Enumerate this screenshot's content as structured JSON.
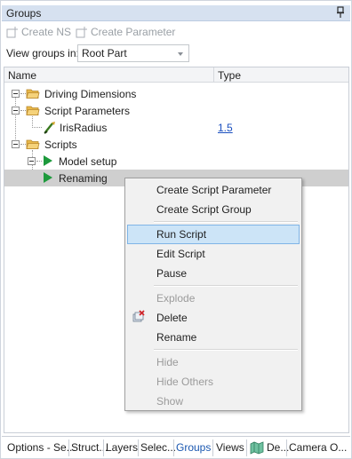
{
  "panel": {
    "title": "Groups"
  },
  "toolbar": {
    "create_ns": "Create NS",
    "create_parameter": "Create Parameter"
  },
  "view_groups": {
    "label": "View groups in:",
    "selected": "Root Part"
  },
  "grid": {
    "columns": [
      "Name",
      "Type"
    ],
    "rows": [
      {
        "label": "Driving Dimensions",
        "type": ""
      },
      {
        "label": "Script Parameters",
        "type": ""
      },
      {
        "label": "IrisRadius",
        "type": "1.5"
      },
      {
        "label": "Scripts",
        "type": ""
      },
      {
        "label": "Model setup",
        "type": ""
      },
      {
        "label": "Renaming",
        "type": ""
      }
    ]
  },
  "context_menu": {
    "items": [
      {
        "label": "Create Script Parameter",
        "enabled": true
      },
      {
        "label": "Create Script Group",
        "enabled": true
      },
      {
        "label": "Run Script",
        "enabled": true,
        "highlighted": true
      },
      {
        "label": "Edit Script",
        "enabled": true
      },
      {
        "label": "Pause",
        "enabled": true
      },
      {
        "label": "Explode",
        "enabled": false
      },
      {
        "label": "Delete",
        "enabled": true,
        "icon": "delete-icon"
      },
      {
        "label": "Rename",
        "enabled": true
      },
      {
        "label": "Hide",
        "enabled": false
      },
      {
        "label": "Hide Others",
        "enabled": false
      },
      {
        "label": "Show",
        "enabled": false
      }
    ]
  },
  "tabs": [
    {
      "label": "Options - Se..."
    },
    {
      "label": "Struct..."
    },
    {
      "label": "Layers"
    },
    {
      "label": "Selec..."
    },
    {
      "label": "Groups",
      "active": true
    },
    {
      "label": "Views"
    },
    {
      "label": "De...",
      "icon": "map-icon"
    },
    {
      "label": "Camera O..."
    }
  ],
  "colors": {
    "title_bar": "#d6e1f0",
    "selection": "#cfcfcf",
    "menu_highlight": "#cce4f7",
    "link": "#1a4fbf",
    "script_play": "#1d9a3c",
    "folder": "#e8b84a"
  }
}
